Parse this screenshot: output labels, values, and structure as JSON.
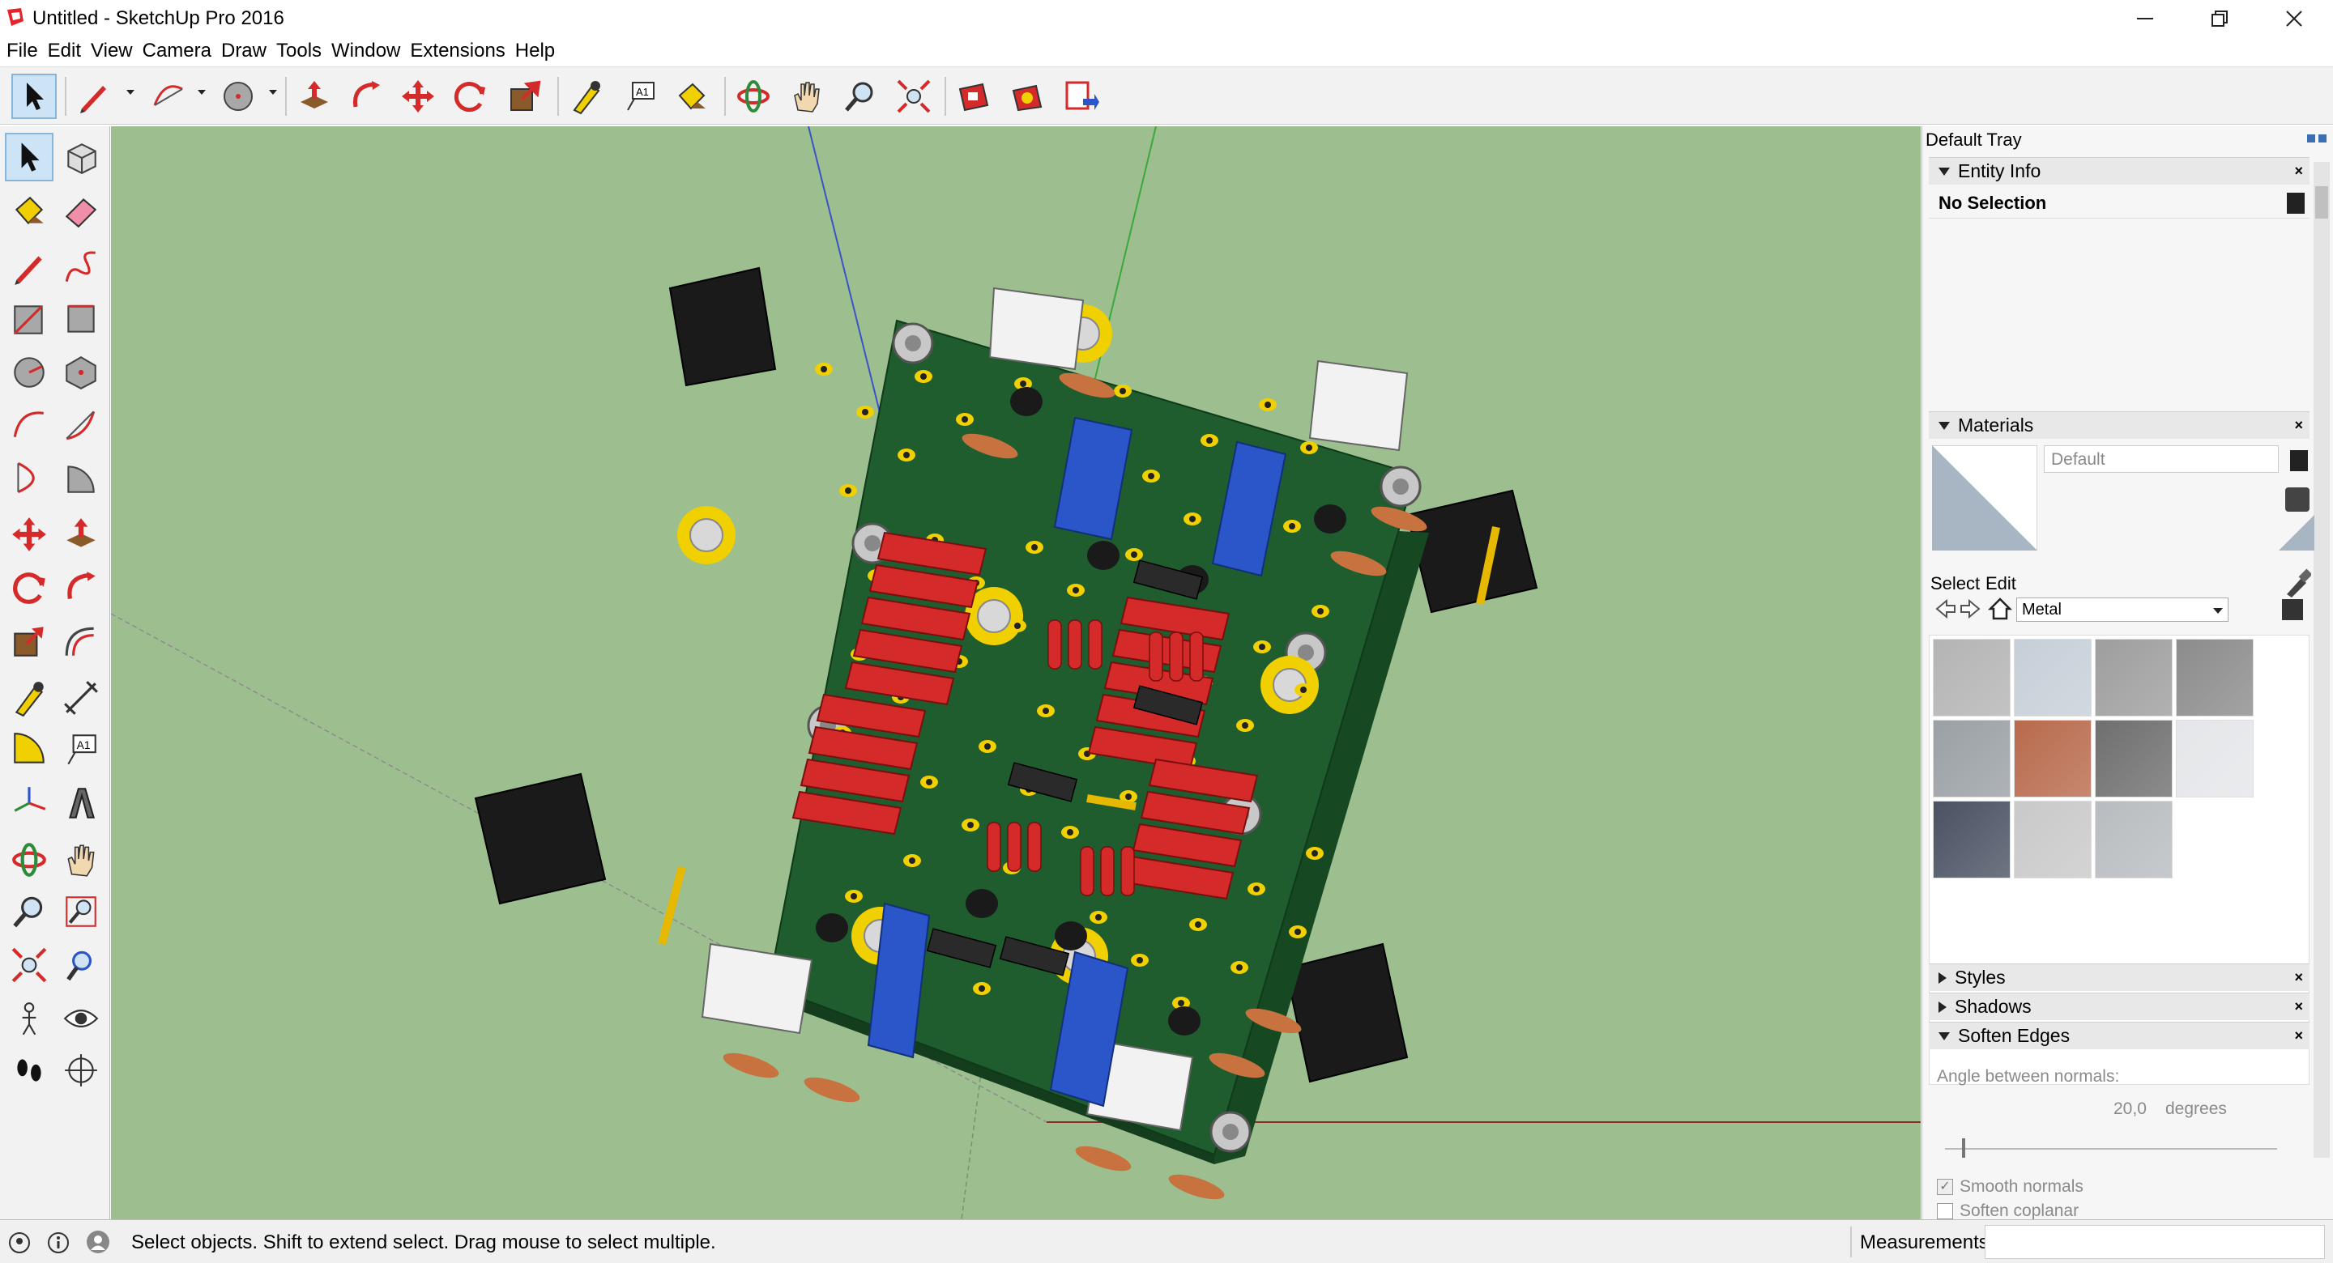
{
  "window": {
    "title": "Untitled - SketchUp Pro 2016"
  },
  "menu": [
    "File",
    "Edit",
    "View",
    "Camera",
    "Draw",
    "Tools",
    "Window",
    "Extensions",
    "Help"
  ],
  "tray": {
    "title": "Default Tray",
    "entity_info": {
      "header": "Entity Info",
      "selection": "No Selection"
    },
    "materials": {
      "header": "Materials",
      "current": "Default",
      "tab_select": "Select",
      "tab_edit": "Edit",
      "library": "Metal",
      "swatch_colors": [
        "#b4b4b4",
        "#c6cfd8",
        "#9e9e9e",
        "#8c8c8c",
        "#9aa0a5",
        "#b86a4c",
        "#6e6f6e",
        "#e4e6e9",
        "#4a5263",
        "#c9c9c9",
        "#b8bcc0"
      ]
    },
    "styles": {
      "header": "Styles"
    },
    "shadows": {
      "header": "Shadows"
    },
    "soften": {
      "header": "Soften Edges",
      "angle_label": "Angle between normals:",
      "angle_value": "20,0",
      "angle_unit": "degrees",
      "slider_value": 0.2,
      "smooth_label": "Smooth normals",
      "smooth_checked": true,
      "coplanar_label": "Soften coplanar",
      "coplanar_checked": false
    }
  },
  "status": {
    "hint": "Select objects. Shift to extend select. Drag mouse to select multiple.",
    "measurements_label": "Measurements",
    "measurements_value": ""
  },
  "colors": {
    "viewport": "#9dbf8f",
    "pcb": "#1f5c2e",
    "resistor": "#d42a2a",
    "trimmer": "#2a56c9",
    "pad": "#f0d000",
    "mount": "#1a1a1a"
  }
}
